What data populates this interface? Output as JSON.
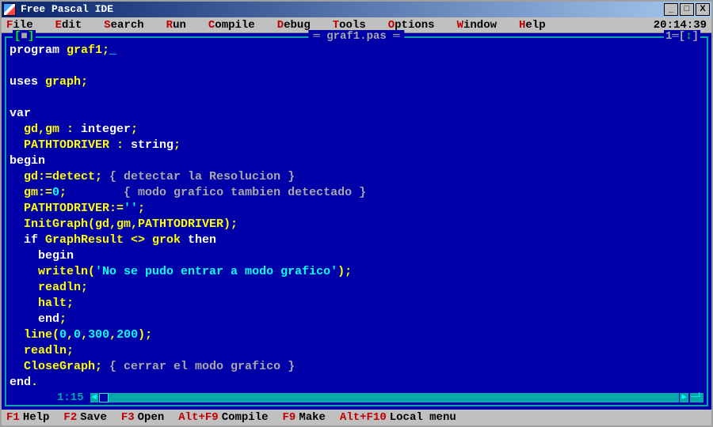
{
  "window": {
    "title": "Free Pascal IDE"
  },
  "menu": {
    "file": "File",
    "edit": "Edit",
    "search": "Search",
    "run": "Run",
    "compile": "Compile",
    "debug": "Debug",
    "tools": "Tools",
    "options": "Options",
    "windowm": "Window",
    "help": "Help",
    "clock": "20:14:39"
  },
  "editor": {
    "filename": "graf1.pas",
    "window_number": "1",
    "cursor_pos": "1:15",
    "code": {
      "l1a": "program",
      "l1b": " graf1;",
      "l2a": "uses",
      "l2b": " graph;",
      "l3": "var",
      "l4a": "  gd,gm : ",
      "l4b": "integer",
      "l4c": ";",
      "l5a": "  PATHTODRIVER : ",
      "l5b": "string",
      "l5c": ";",
      "l6": "begin",
      "l7a": "  gd:=detect; ",
      "l7b": "{ detectar la Resolucion }",
      "l8a": "  gm:=",
      "l8b": "0",
      "l8c": ";        ",
      "l8d": "{ modo grafico tambien detectado }",
      "l9a": "  PATHTODRIVER:=",
      "l9b": "''",
      "l9c": ";",
      "l10": "  InitGraph(gd,gm,PATHTODRIVER);",
      "l11a": "  if",
      "l11b": " GraphResult <> grok ",
      "l11c": "then",
      "l12": "    begin",
      "l13a": "    writeln(",
      "l13b": "'No se pudo entrar a modo grafico'",
      "l13c": ");",
      "l14": "    readln;",
      "l15": "    halt;",
      "l16a": "    end",
      "l16b": ";",
      "l17a": "  line(",
      "l17b": "0",
      "l17c": ",",
      "l17d": "0",
      "l17e": ",",
      "l17f": "300",
      "l17g": ",",
      "l17h": "200",
      "l17i": ");",
      "l18": "  readln;",
      "l19a": "  CloseGraph; ",
      "l19b": "{ cerrar el modo grafico }",
      "l20a": "end",
      "l20b": "."
    }
  },
  "status": {
    "f1k": "F1",
    "f1": "Help",
    "f2k": "F2",
    "f2": "Save",
    "f3k": "F3",
    "f3": "Open",
    "af9k": "Alt+F9",
    "af9": "Compile",
    "f9k": "F9",
    "f9": "Make",
    "af10k": "Alt+F10",
    "af10": "Local menu"
  }
}
